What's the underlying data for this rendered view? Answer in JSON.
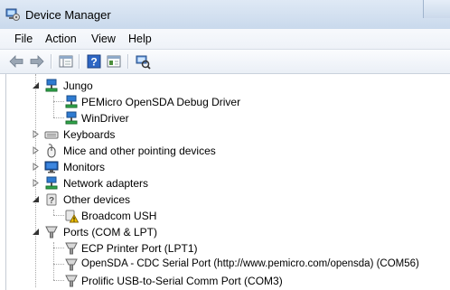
{
  "window": {
    "title": "Device Manager",
    "bg_ghost_text": [
      "",
      "",
      ""
    ]
  },
  "menu": {
    "items": [
      "File",
      "Action",
      "View",
      "Help"
    ]
  },
  "toolbar": {
    "buttons": [
      "back-arrow-icon",
      "forward-arrow-icon",
      "console-tree-icon",
      "help-icon",
      "properties-icon",
      "scan-hardware-icon"
    ]
  },
  "tree": {
    "jungo": {
      "label": "Jungo",
      "children": [
        "PEMicro OpenSDA Debug Driver",
        "WinDriver"
      ]
    },
    "keyboards": {
      "label": "Keyboards"
    },
    "mice": {
      "label": "Mice and other pointing devices"
    },
    "monitors": {
      "label": "Monitors"
    },
    "network": {
      "label": "Network adapters"
    },
    "other": {
      "label": "Other devices",
      "children": [
        "Broadcom USH"
      ]
    },
    "ports": {
      "label": "Ports (COM & LPT)",
      "children": [
        "ECP Printer Port (LPT1)",
        "OpenSDA - CDC Serial Port (http://www.pemicro.com/opensda) (COM56)",
        "Prolific USB-to-Serial Comm Port (COM3)"
      ]
    }
  },
  "colors": {
    "accent": "#2a6fc9",
    "warning": "#f2c200",
    "tree_line": "#a8a8a8"
  }
}
